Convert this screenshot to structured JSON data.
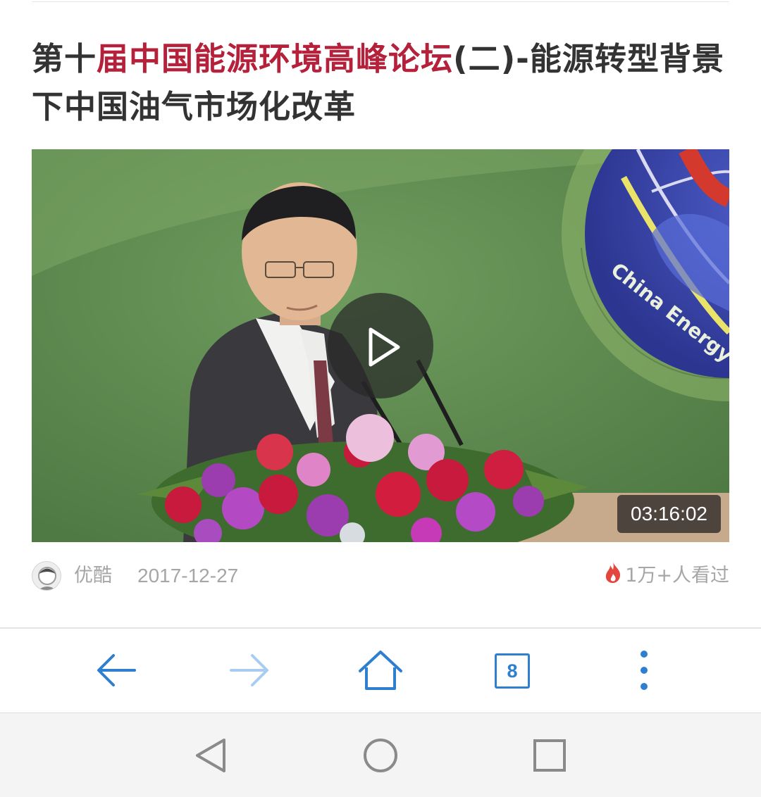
{
  "article": {
    "title_prefix": "第十",
    "title_highlight": "届中国能源环境高峰论坛",
    "title_suffix": "(二)-能源转型背景下中国油气市场化改革",
    "highlight_color": "#b5213a"
  },
  "video": {
    "duration": "03:16:02",
    "backdrop_text": "China Energy"
  },
  "meta": {
    "source": "优酷",
    "date": "2017-12-27",
    "views": "1万+人看过"
  },
  "toolbar": {
    "tab_count": "8",
    "accent_color": "#2f7fd0"
  },
  "icons": {
    "back": "arrow-left-icon",
    "forward": "arrow-right-icon",
    "home": "home-icon",
    "tabs": "tabs-icon",
    "menu": "more-vertical-icon",
    "nav_back": "triangle-back-icon",
    "nav_home": "circle-home-icon",
    "nav_recents": "square-recents-icon",
    "play": "play-icon",
    "fire": "fire-icon"
  }
}
